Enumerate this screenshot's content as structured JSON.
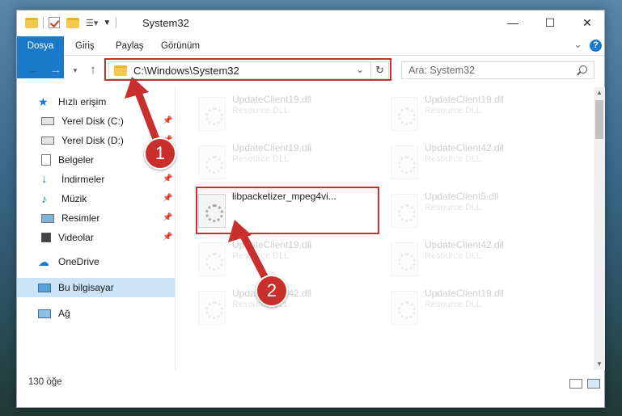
{
  "window": {
    "title": "System32",
    "controls": {
      "minimize": "—",
      "maximize": "☐",
      "close": "✕"
    }
  },
  "ribbon": {
    "tabs": [
      "Dosya",
      "Giriş",
      "Paylaş",
      "Görünüm"
    ],
    "expand": "⌄",
    "help": "?"
  },
  "address": {
    "path": "C:\\Windows\\System32",
    "search_placeholder": "Ara: System32"
  },
  "nav": {
    "quick_access": "Hızlı erişim",
    "items": [
      {
        "label": "Yerel Disk (C:)",
        "icon": "drive-icon",
        "pinned": true
      },
      {
        "label": "Yerel Disk (D:)",
        "icon": "drive-icon",
        "pinned": true
      },
      {
        "label": "Belgeler",
        "icon": "documents-icon",
        "pinned": true
      },
      {
        "label": "İndirmeler",
        "icon": "downloads-icon",
        "pinned": true
      },
      {
        "label": "Müzik",
        "icon": "music-icon",
        "pinned": true
      },
      {
        "label": "Resimler",
        "icon": "pictures-icon",
        "pinned": true
      },
      {
        "label": "Videolar",
        "icon": "videos-icon",
        "pinned": true
      }
    ],
    "onedrive": "OneDrive",
    "this_pc": "Bu bilgisayar",
    "network": "Ağ"
  },
  "files": {
    "left": [
      {
        "name": "UpdateClient19.dll",
        "type": "Resource DLL"
      },
      {
        "name": "UpdateClient19.dll",
        "type": "Resource DLL"
      },
      {
        "name": "libpacketizer_mpeg4vi...",
        "type": ""
      },
      {
        "name": "UpdateClient19.dll",
        "type": "Resource DLL"
      },
      {
        "name": "UpdateClient42.dll",
        "type": "Resource DLL"
      }
    ],
    "right": [
      {
        "name": "UpdateClient19.dll",
        "type": "Resource DLL"
      },
      {
        "name": "UpdateClient42.dll",
        "type": "Resource DLL"
      },
      {
        "name": "UpdateClient5.dll",
        "type": "Resource DLL"
      },
      {
        "name": "UpdateClient42.dll",
        "type": "Resource DLL"
      },
      {
        "name": "UpdateClient19.dll",
        "type": "Resource DLL"
      }
    ]
  },
  "status": {
    "count": "130 öğe"
  },
  "annotations": {
    "step1": "1",
    "step2": "2"
  },
  "colors": {
    "accent": "#1979ca",
    "highlight": "#c9302c",
    "selected": "#cce4f7"
  }
}
